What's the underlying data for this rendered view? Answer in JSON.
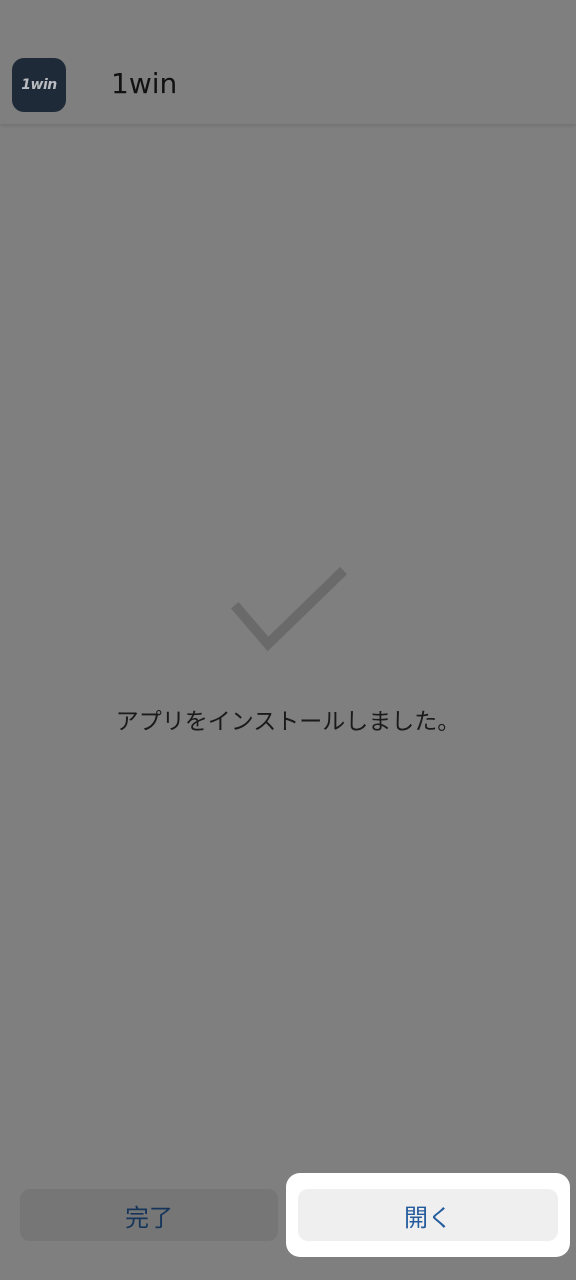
{
  "header": {
    "app_icon_text": "1win",
    "app_name": "1win"
  },
  "main": {
    "status_icon": "checkmark-icon",
    "message": "アプリをインストールしました。"
  },
  "actions": {
    "done_label": "完了",
    "open_label": "開く"
  },
  "colors": {
    "background": "#7f7f7f",
    "button_text": "#245b9c",
    "highlight": "#ffffff"
  }
}
